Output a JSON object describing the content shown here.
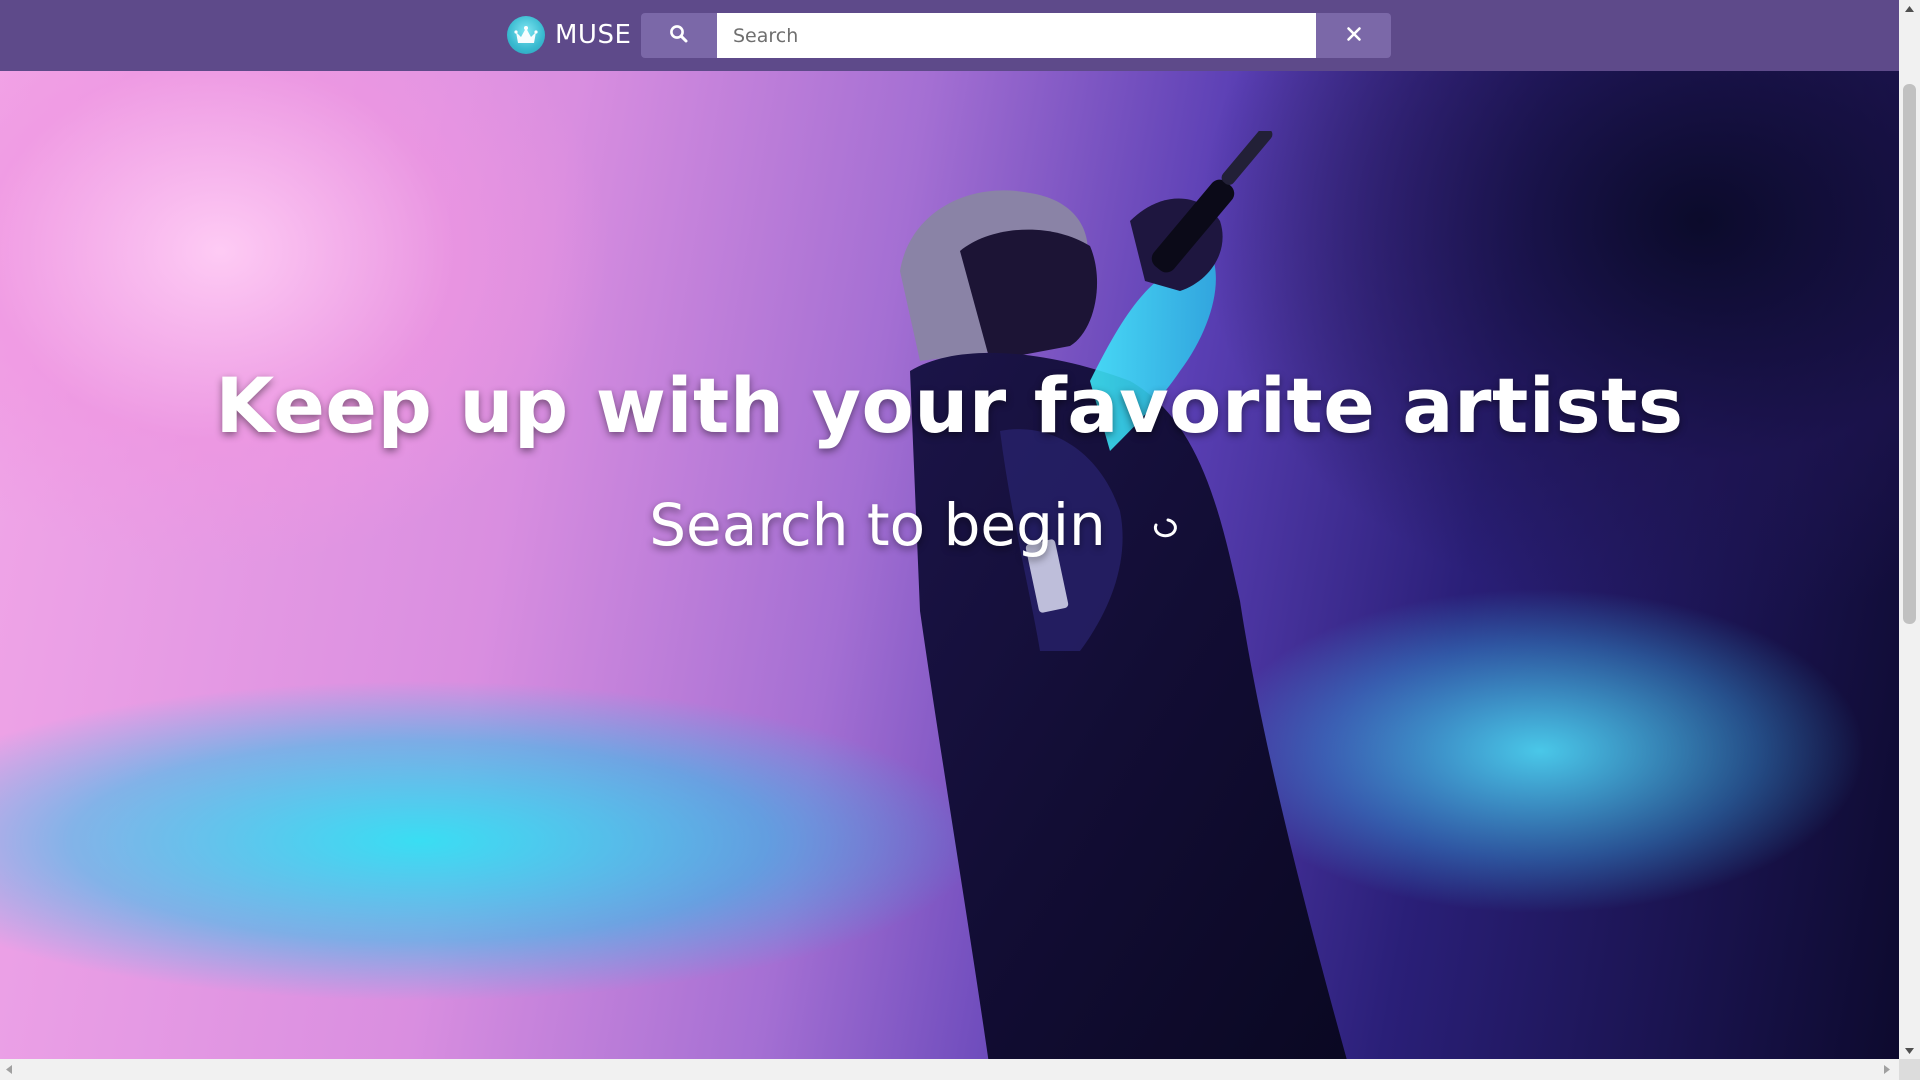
{
  "header": {
    "brand": "MUSE",
    "logo_icon": "crown-icon",
    "search": {
      "placeholder": "Search",
      "value": "",
      "search_icon": "search-icon",
      "clear_label": "X"
    }
  },
  "hero": {
    "title": "Keep up with your favorite artists",
    "subtitle": "Search to begin",
    "loading_icon": "spinner-icon",
    "background": "concert-performer-photo"
  },
  "colors": {
    "navbar": "#5e4a8a",
    "button": "#7b68a8",
    "logo": "#38b9cf",
    "text": "#ffffff"
  }
}
